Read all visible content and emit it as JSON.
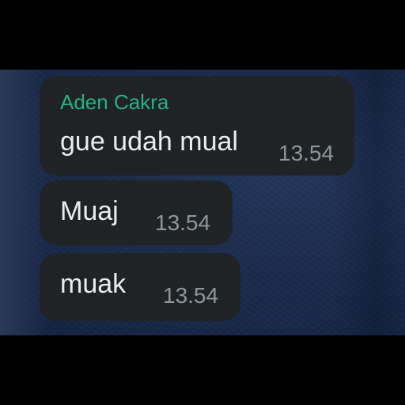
{
  "colors": {
    "background": "#000000",
    "wallpaper": "#1a2b4b",
    "bubble": "#1f2326",
    "sender_name": "#25b27f",
    "message_text": "#e9edef",
    "timestamp": "#8d969b"
  },
  "messages": [
    {
      "sender": "Aden Cakra",
      "text": "gue udah mual",
      "time": "13.54"
    },
    {
      "text": "Muaj",
      "time": "13.54"
    },
    {
      "text": "muak",
      "time": "13.54"
    }
  ]
}
